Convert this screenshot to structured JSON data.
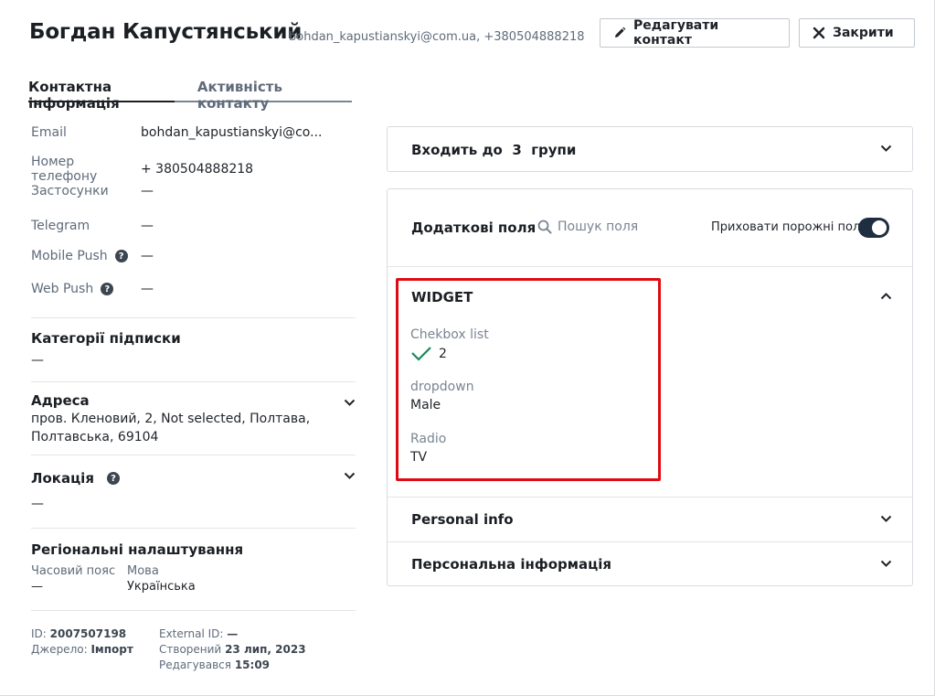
{
  "header": {
    "name": "Богдан Капустянський",
    "contacts": "bohdan_kapustianskyi@com.ua, +380504888218",
    "edit_label": "Редагувати контакт",
    "close_label": "Закрити"
  },
  "tabs": [
    {
      "label": "Контактна інформація",
      "active": true
    },
    {
      "label": "Активність контакту",
      "active": false
    }
  ],
  "contact": {
    "email_label": "Email",
    "email_value": "bohdan_kapustianskyi@co...",
    "phone_label": "Номер телефону",
    "phone_value": "+ 380504888218",
    "apps_label": "Застосунки",
    "apps_value": "—",
    "telegram_label": "Telegram",
    "telegram_value": "—",
    "mobile_push_label": "Mobile Push",
    "mobile_push_value": "—",
    "web_push_label": "Web Push",
    "web_push_value": "—"
  },
  "subscriptions": {
    "title": "Категорії підписки",
    "value": "—"
  },
  "address": {
    "title": "Адреса",
    "line1": "пров. Кленовий, 2, Not selected, Полтава,",
    "line2": "Полтавська, 69104"
  },
  "location": {
    "title": "Локація",
    "value": "—"
  },
  "regional": {
    "title": "Регіональні налаштування",
    "tz_label": "Часовий пояс",
    "tz_value": "—",
    "lang_label": "Мова",
    "lang_value": "Українська"
  },
  "meta": {
    "id_label": "ID:",
    "id_value": "2007507198",
    "source_label": "Джерело:",
    "source_value": "Імпорт",
    "external_label": "External ID:",
    "external_value": "—",
    "created_label": "Створений",
    "created_value": "23 лип, 2023",
    "edited_label": "Редагувався",
    "edited_value": "15:09"
  },
  "groups": {
    "prefix": "Входить до",
    "count": "3",
    "suffix": "групи"
  },
  "extra_fields": {
    "title": "Додаткові поля",
    "search_placeholder": "Пошук поля",
    "hide_empty_label": "Приховати порожні поля",
    "hide_empty_on": true,
    "widget": {
      "title": "WIDGET",
      "checkbox_label": "Chekbox list",
      "checkbox_value": "2",
      "dropdown_label": "dropdown",
      "dropdown_value": "Male",
      "radio_label": "Radio",
      "radio_value": "TV"
    },
    "personal_info_en": "Personal info",
    "personal_info_ua": "Персональна інформація"
  },
  "colors": {
    "highlight": "#e00b12",
    "toggle": "#1f2d40",
    "check": "#1a8a5a"
  }
}
